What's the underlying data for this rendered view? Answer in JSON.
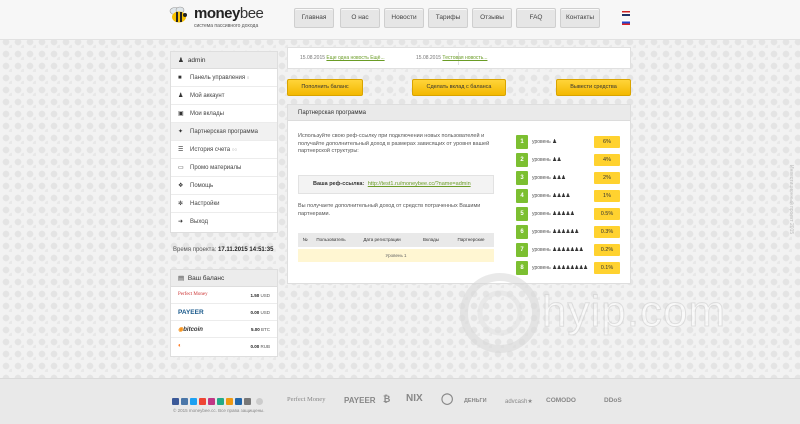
{
  "brand": {
    "name_bold": "money",
    "name_light": "bee",
    "tagline": "система пассивного дохода"
  },
  "nav": [
    "Главная",
    "О нас",
    "Новости",
    "Тарифы",
    "Отзывы",
    "FAQ",
    "Контакты"
  ],
  "sidebar": {
    "user": "admin",
    "user_icon": "user-icon",
    "items": [
      {
        "label": "Панель управления",
        "icon": "lock-icon",
        "sub": "○"
      },
      {
        "label": "Мой аккаунт",
        "icon": "user-icon",
        "sub": ""
      },
      {
        "label": "Мои вклады",
        "icon": "briefcase-icon",
        "sub": ""
      },
      {
        "label": "Партнерская программа",
        "icon": "pin-icon",
        "sub": ""
      },
      {
        "label": "История счета",
        "icon": "list-icon",
        "sub": "○○"
      },
      {
        "label": "Промо материалы",
        "icon": "monitor-icon",
        "sub": ""
      },
      {
        "label": "Помощь",
        "icon": "help-icon",
        "sub": ""
      },
      {
        "label": "Настройки",
        "icon": "gear-icon",
        "sub": ""
      },
      {
        "label": "Выход",
        "icon": "exit-icon",
        "sub": ""
      }
    ],
    "server_time_label": "Время проекта:",
    "server_time": "17.11.2015 14:51:35",
    "balance_title": "Ваш баланс",
    "balances": [
      {
        "system": "Perfect Money",
        "amount": "1.50",
        "currency": "USD"
      },
      {
        "system": "PAYEER",
        "amount": "0.00",
        "currency": "USD"
      },
      {
        "system": "bitcoin",
        "amount": "5.00",
        "currency": "BTC"
      },
      {
        "system": "",
        "amount": "0.00",
        "currency": "RUB"
      }
    ]
  },
  "news": [
    {
      "date": "15.08.2015",
      "title": "Еще одна новость Ещё..."
    },
    {
      "date": "15.08.2015",
      "title": "Тестовая новость..."
    }
  ],
  "actions": [
    "Пополнить баланс",
    "Сделать вклад с баланса",
    "Вывести средства"
  ],
  "partner": {
    "title": "Партнерская программа",
    "intro": "Используйте свою реф-ссылку при подключении новых пользователей и получайте дополнительный доход в размерах зависящих от уровня вашей партнерской структуры:",
    "ref_label": "Ваша реф-ссылка:",
    "ref_link": "http://test1.ru/moneybee.cc/?name=admin",
    "income_text": "Вы получаете дополнительный доход от средств потраченных Вашими партнерами.",
    "table_headers": [
      "№",
      "Пользователь",
      "Дата регистрации",
      "Вклады",
      "Партнерские"
    ],
    "table_row": "Уровень 1",
    "level_word": "уровень",
    "levels": [
      {
        "n": "1",
        "pct": "6%",
        "men": "♟"
      },
      {
        "n": "2",
        "pct": "4%",
        "men": "♟♟"
      },
      {
        "n": "3",
        "pct": "2%",
        "men": "♟♟♟"
      },
      {
        "n": "4",
        "pct": "1%",
        "men": "♟♟♟♟"
      },
      {
        "n": "5",
        "pct": "0.5%",
        "men": "♟♟♟♟♟"
      },
      {
        "n": "6",
        "pct": "0.3%",
        "men": "♟♟♟♟♟♟"
      },
      {
        "n": "7",
        "pct": "0.2%",
        "men": "♟♟♟♟♟♟♟"
      },
      {
        "n": "8",
        "pct": "0.1%",
        "men": "♟♟♟♟♟♟♟♟"
      }
    ]
  },
  "watermark": "hyip.com",
  "side_ad": "Инвестиционный проект 2015",
  "footer": {
    "copyright": "© 2015 moneybee.cc. Все права защищены.",
    "payment_logos": [
      "Perfect Money",
      "PAYEER",
      "₿",
      "NIX",
      "◯",
      "ДЕНЬГИ",
      "advcash★",
      "COMODO",
      "DDoS"
    ],
    "social_colors": [
      "#3b5998",
      "#4a76a8",
      "#1da1f2",
      "#e43",
      "#c13584",
      "#2a8",
      "#e91",
      "#26a",
      "#777"
    ]
  }
}
